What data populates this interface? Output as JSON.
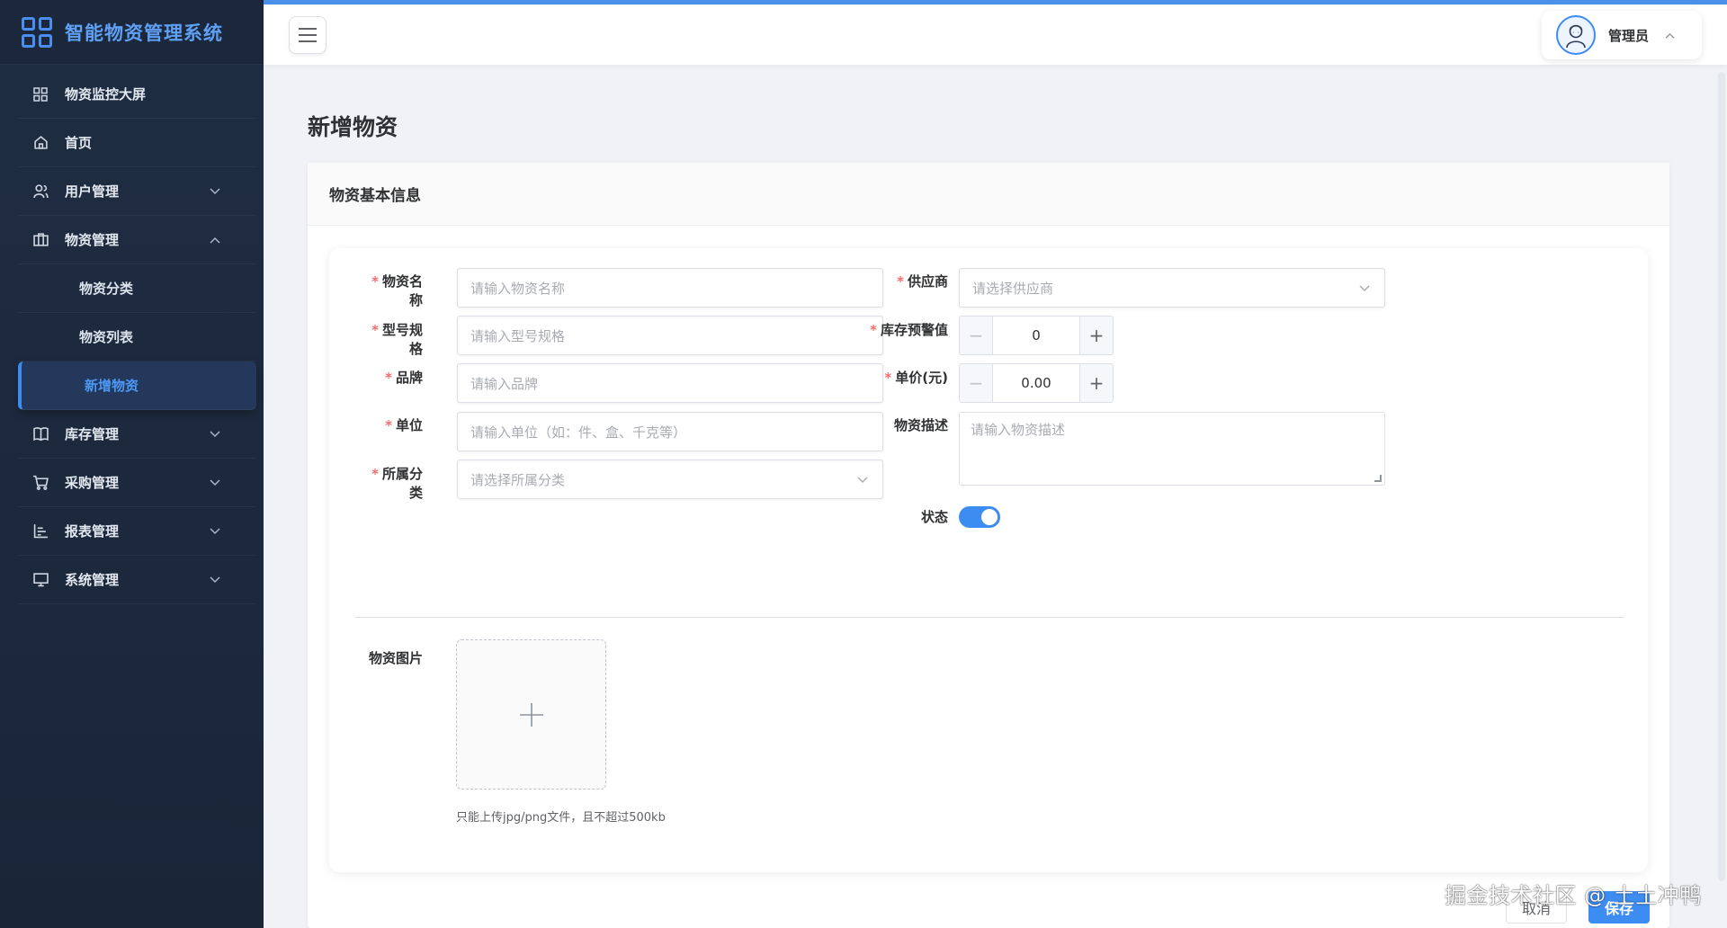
{
  "app": {
    "title": "智能物资管理系统"
  },
  "sidebar": {
    "items": [
      {
        "label": "物资监控大屏",
        "icon": "grid-icon",
        "has_chevron": false
      },
      {
        "label": "首页",
        "icon": "home-icon",
        "has_chevron": false
      },
      {
        "label": "用户管理",
        "icon": "users-icon",
        "has_chevron": true,
        "expanded": false
      },
      {
        "label": "物资管理",
        "icon": "briefcase-icon",
        "has_chevron": true,
        "expanded": true
      },
      {
        "label": "库存管理",
        "icon": "book-icon",
        "has_chevron": true,
        "expanded": false
      },
      {
        "label": "采购管理",
        "icon": "cart-icon",
        "has_chevron": true,
        "expanded": false
      },
      {
        "label": "报表管理",
        "icon": "chart-icon",
        "has_chevron": true,
        "expanded": false
      },
      {
        "label": "系统管理",
        "icon": "monitor-icon",
        "has_chevron": true,
        "expanded": false
      }
    ],
    "sub_items": [
      {
        "label": "物资分类",
        "active": false
      },
      {
        "label": "物资列表",
        "active": false
      },
      {
        "label": "新增物资",
        "active": true
      }
    ]
  },
  "header": {
    "user_name": "管理员",
    "avatar_icon": "user-avatar-icon"
  },
  "page": {
    "title": "新增物资"
  },
  "card": {
    "title": "物资基本信息"
  },
  "form": {
    "name": {
      "label": "物资名称",
      "placeholder": "请输入物资名称",
      "required": true
    },
    "model": {
      "label": "型号规格",
      "placeholder": "请输入型号规格",
      "required": true
    },
    "brand": {
      "label": "品牌",
      "placeholder": "请输入品牌",
      "required": true
    },
    "unit": {
      "label": "单位",
      "placeholder": "请输入单位（如：件、盒、千克等）",
      "required": true
    },
    "category": {
      "label": "所属分类",
      "placeholder": "请选择所属分类",
      "required": true
    },
    "supplier": {
      "label": "供应商",
      "placeholder": "请选择供应商",
      "required": true
    },
    "stock_alert": {
      "label": "库存预警值",
      "value": "0",
      "required": true
    },
    "price": {
      "label": "单价(元)",
      "value": "0.00",
      "required": true
    },
    "description": {
      "label": "物资描述",
      "placeholder": "请输入物资描述"
    },
    "status": {
      "label": "状态",
      "enabled": true
    },
    "image": {
      "label": "物资图片",
      "tip": "只能上传jpg/png文件，且不超过500kb"
    }
  },
  "actions": {
    "cancel_label": "取消",
    "save_label": "保存"
  },
  "watermark": "掘金技术社区 @ 土土冲鸭",
  "colors": {
    "accent": "#3c8cf2",
    "sidebar_bg": "#1f2d42",
    "required": "#f56c6c"
  }
}
